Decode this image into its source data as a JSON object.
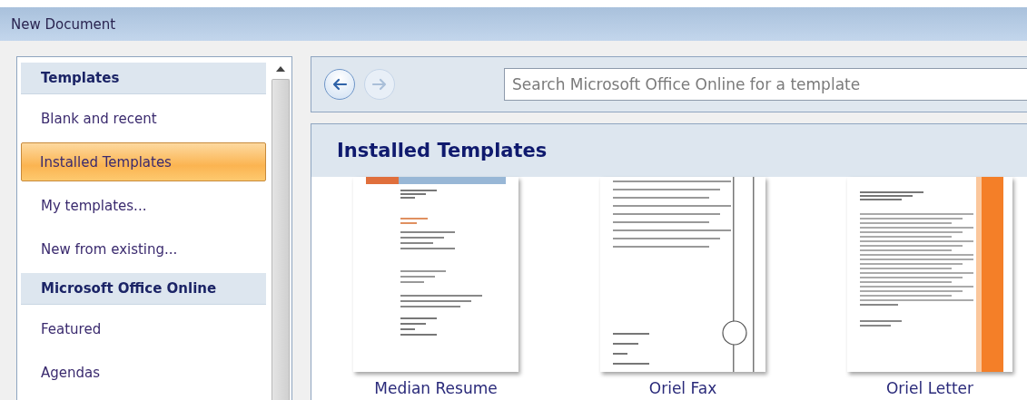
{
  "window": {
    "title": "New Document"
  },
  "sidebar": {
    "items": [
      {
        "kind": "header",
        "label": "Templates"
      },
      {
        "kind": "item",
        "label": "Blank and recent",
        "selected": false
      },
      {
        "kind": "item",
        "label": "Installed Templates",
        "selected": true
      },
      {
        "kind": "item",
        "label": "My templates...",
        "selected": false
      },
      {
        "kind": "item",
        "label": "New from existing...",
        "selected": false
      },
      {
        "kind": "header",
        "label": "Microsoft Office Online"
      },
      {
        "kind": "item",
        "label": "Featured",
        "selected": false
      },
      {
        "kind": "item",
        "label": "Agendas",
        "selected": false
      }
    ]
  },
  "toolbar": {
    "back": {
      "disabled": false
    },
    "forward": {
      "disabled": true
    },
    "search": {
      "placeholder": "Search Microsoft Office Online for a template"
    }
  },
  "gallery": {
    "title": "Installed Templates",
    "templates": [
      {
        "kind": "resume",
        "name": "Median Resume"
      },
      {
        "kind": "fax",
        "name": "Oriel Fax"
      },
      {
        "kind": "letter",
        "name": "Oriel Letter"
      }
    ]
  }
}
